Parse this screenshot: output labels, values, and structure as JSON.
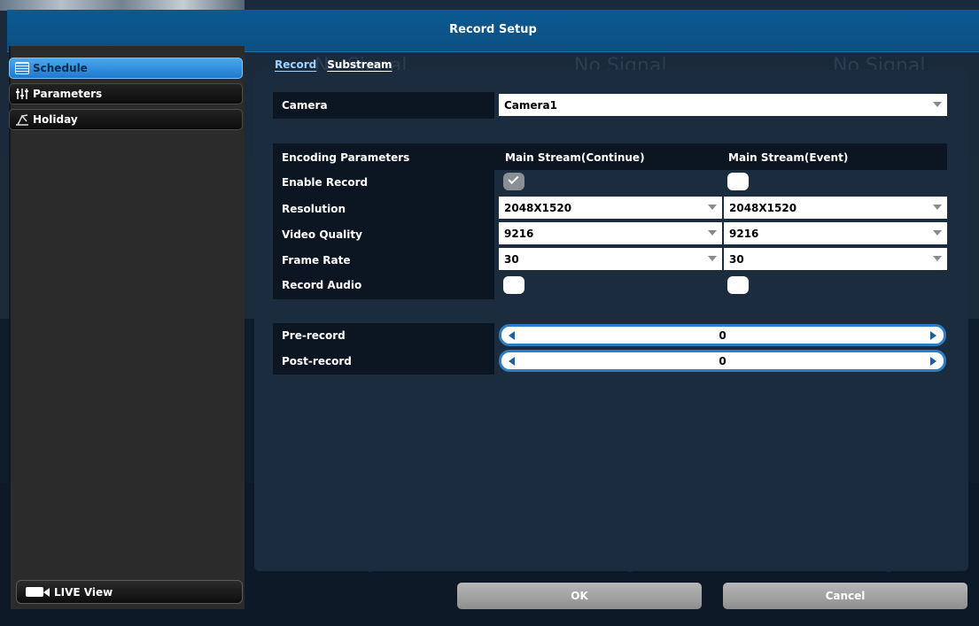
{
  "window": {
    "title": "Record Setup"
  },
  "background": {
    "no_signal_text": "No Signal"
  },
  "sidebar": {
    "items": [
      {
        "label": "Schedule",
        "icon": "calendar-icon",
        "active": true
      },
      {
        "label": "Parameters",
        "icon": "sliders-icon",
        "active": false
      },
      {
        "label": "Holiday",
        "icon": "holiday-icon",
        "active": false
      }
    ],
    "live_view_label": "LIVE View"
  },
  "tabs": [
    {
      "label": "Record",
      "active": true
    },
    {
      "label": "Substream",
      "active": false
    }
  ],
  "camera": {
    "label": "Camera",
    "value": "Camera1"
  },
  "encoding": {
    "header_label": "Encoding Parameters",
    "col_continue": "Main Stream(Continue)",
    "col_event": "Main Stream(Event)",
    "enable_record": {
      "label": "Enable Record",
      "continue": true,
      "event": false
    },
    "resolution": {
      "label": "Resolution",
      "continue": "2048X1520",
      "event": "2048X1520"
    },
    "video_quality": {
      "label": "Video Quality",
      "continue": "9216",
      "event": "9216"
    },
    "frame_rate": {
      "label": "Frame Rate",
      "continue": "30",
      "event": "30"
    },
    "record_audio": {
      "label": "Record Audio",
      "continue": false,
      "event": false
    }
  },
  "pre_record": {
    "label": "Pre-record",
    "value": "0"
  },
  "post_record": {
    "label": "Post-record",
    "value": "0"
  },
  "buttons": {
    "ok": "OK",
    "cancel": "Cancel"
  },
  "colors": {
    "title_bar": "#0a5a93",
    "active_item": "#3a95e6",
    "panel": "#1a2c3e"
  }
}
